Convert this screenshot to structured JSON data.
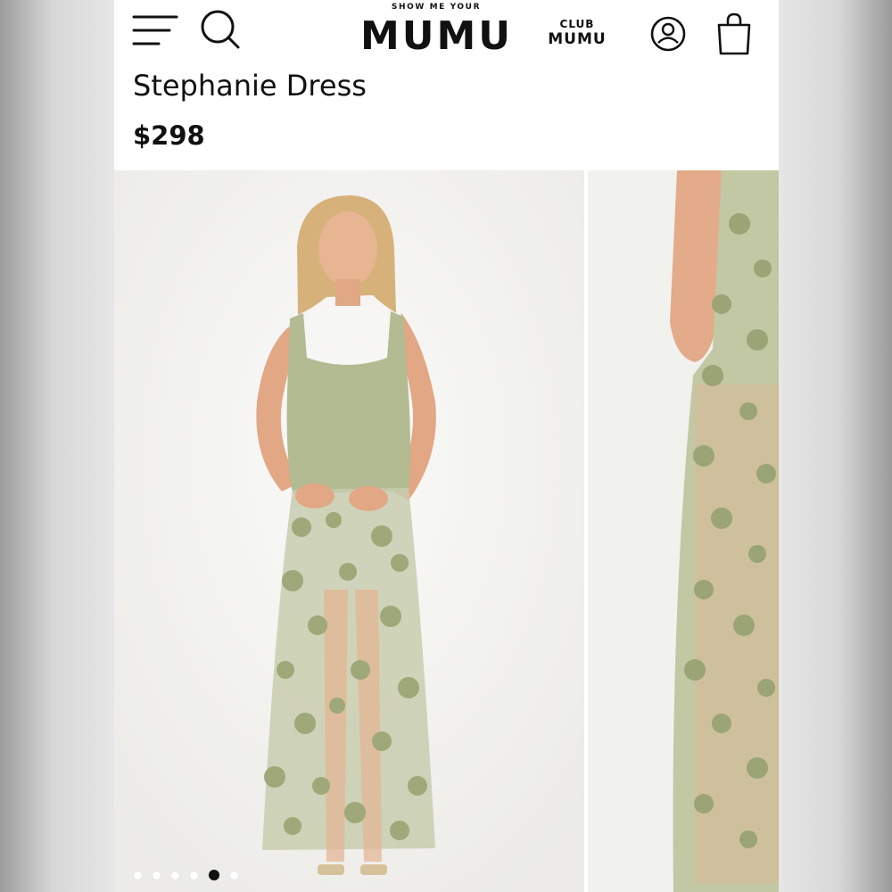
{
  "header": {
    "brand_small": "SHOW ME YOUR",
    "brand_name": "MUMU",
    "club_top": "CLUB",
    "club_bottom": "MUMU"
  },
  "product": {
    "title": "Stephanie Dress",
    "price": "$298"
  },
  "gallery": {
    "slide_count": 6,
    "active_slide": 5
  },
  "colors": {
    "dress_sage": "#a9b48a",
    "text": "#111111"
  },
  "icons": [
    "menu-icon",
    "search-icon",
    "account-icon",
    "shopping-bag-icon"
  ]
}
